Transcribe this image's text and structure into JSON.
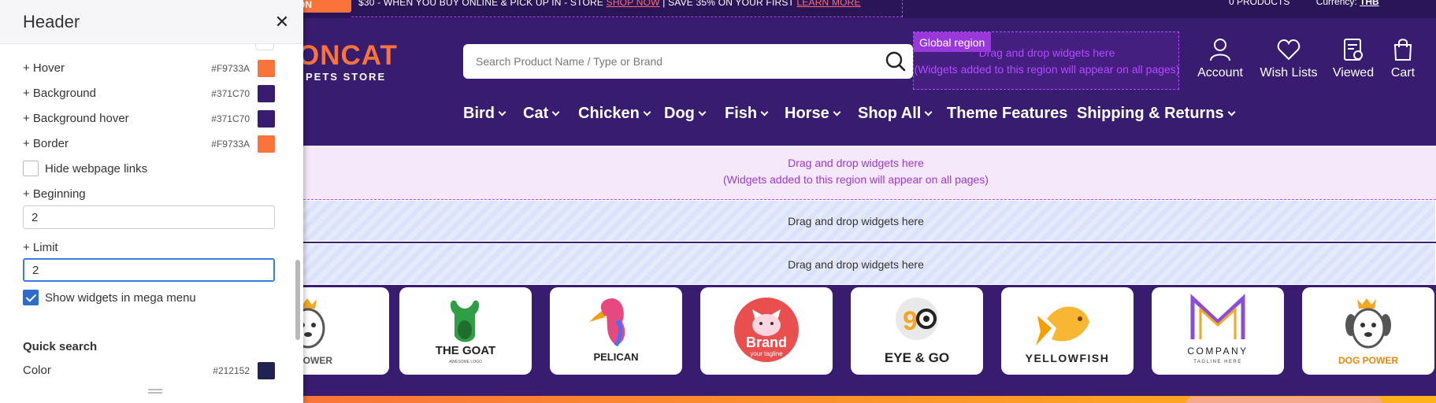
{
  "topbar": {
    "promo_button": "ON",
    "promo_text_1": "$30 - WHEN YOU BUY ONLINE & PICK UP IN - STORE",
    "promo_link_1": "SHOP NOW",
    "promo_text_2": "SAVE 35% ON YOUR FIRST",
    "promo_link_2": "LEARN MORE",
    "right_text": "0 PRODUCTS",
    "currency_label": "Currency:",
    "currency_value": "THB"
  },
  "logo": {
    "name_main": "ONCAT",
    "tagline": "PETS STORE"
  },
  "search": {
    "placeholder": "Search Product Name / Type or Brand"
  },
  "global_region": {
    "tag": "Global region",
    "line1": "Drag and drop widgets here",
    "line2": "(Widgets added to this region will appear on all pages)"
  },
  "header_icons": {
    "account": "Account",
    "wishlists": "Wish Lists",
    "viewed": "Viewed",
    "cart": "Cart"
  },
  "nav": {
    "items": [
      {
        "label": "Bird",
        "dropdown": true
      },
      {
        "label": "Cat",
        "dropdown": true
      },
      {
        "label": "Chicken",
        "dropdown": true
      },
      {
        "label": "Dog",
        "dropdown": true
      },
      {
        "label": "Fish",
        "dropdown": true
      },
      {
        "label": "Horse",
        "dropdown": true
      },
      {
        "label": "Shop All",
        "dropdown": true
      },
      {
        "label": "Theme Features",
        "dropdown": false
      },
      {
        "label": "Shipping & Returns",
        "dropdown": true
      }
    ]
  },
  "regions": {
    "pink_line1": "Drag and drop widgets here",
    "pink_line2": "(Widgets added to this region will appear on all pages)",
    "striped1": "Drag and drop widgets here",
    "striped2": "Drag and drop widgets here"
  },
  "brands": [
    {
      "name": "G POWER",
      "icon": "dog-power-logo"
    },
    {
      "name": "THE GOAT",
      "icon": "the-goat-logo"
    },
    {
      "name": "PELICAN",
      "icon": "pelican-logo"
    },
    {
      "name": "Brand",
      "icon": "brand-cat-logo"
    },
    {
      "name": "EYE & GO",
      "icon": "eye-and-go-logo"
    },
    {
      "name": "YELLOWFISH",
      "icon": "yellowfish-logo"
    },
    {
      "name": "COMPANY",
      "icon": "company-logo"
    },
    {
      "name": "DOG POWER",
      "icon": "dog-power-logo"
    }
  ],
  "brand_extra": {
    "goat_sub": "AWESOME LOGO",
    "brand_sub": "your tagline",
    "company_sub": "TAGLINE HERE"
  },
  "panel": {
    "title": "Header",
    "colors": [
      {
        "label": "+ Hover",
        "hex": "#F9733A"
      },
      {
        "label": "+ Background",
        "hex": "#371C70"
      },
      {
        "label": "+ Background hover",
        "hex": "#371C70"
      },
      {
        "label": "+ Border",
        "hex": "#F9733A"
      }
    ],
    "hide_links_label": "Hide webpage links",
    "hide_links_checked": false,
    "beginning_label": "+ Beginning",
    "beginning_value": "2",
    "limit_label": "+ Limit",
    "limit_value": "2",
    "mega_menu_label": "Show widgets in mega menu",
    "mega_menu_checked": true,
    "quick_search_title": "Quick search",
    "quick_search_color_label": "Color",
    "quick_search_color_hex": "#212152"
  }
}
